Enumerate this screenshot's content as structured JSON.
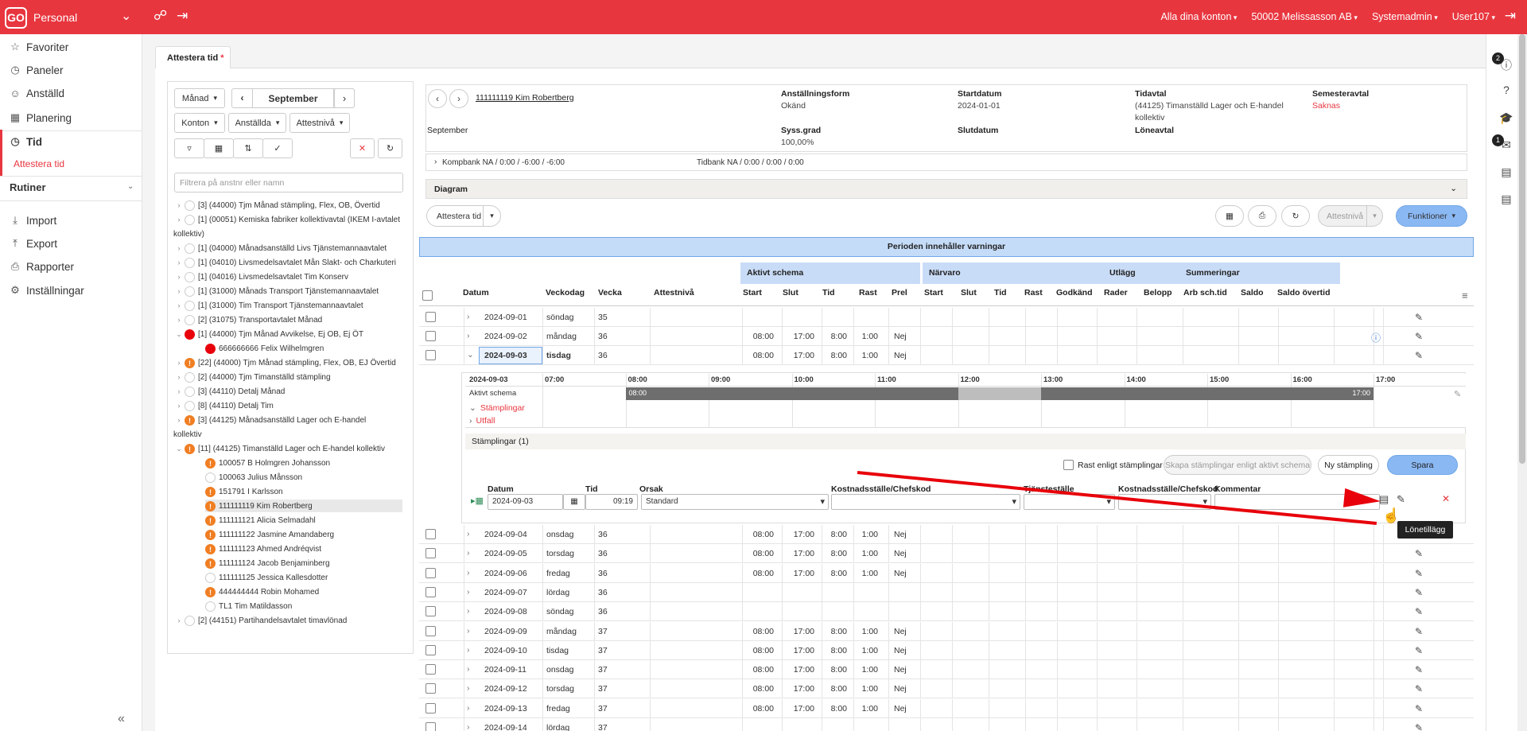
{
  "topbar": {
    "logo": "GO",
    "app_name": "Personal",
    "accounts": "Alla dina konton",
    "company": "50002 Melissasson AB",
    "role": "Systemadmin",
    "user": "User107",
    "icons": [
      "lifebuoy-icon",
      "sign-out-icon",
      "logout-icon"
    ]
  },
  "sidebar": {
    "items": [
      {
        "label": "Favoriter",
        "icon": "star-icon"
      },
      {
        "label": "Paneler",
        "icon": "dashboard-icon"
      },
      {
        "label": "Anställd",
        "icon": "user-icon"
      },
      {
        "label": "Planering",
        "icon": "calendar-icon"
      },
      {
        "label": "Tid",
        "icon": "clock-icon"
      },
      {
        "label": "Import",
        "icon": "import-icon"
      },
      {
        "label": "Export",
        "icon": "export-icon"
      },
      {
        "label": "Rapporter",
        "icon": "print-icon"
      },
      {
        "label": "Inställningar",
        "icon": "gear-icon"
      }
    ],
    "sub_active": "Attestera tid",
    "section": "Rutiner"
  },
  "tab": {
    "label": "Attestera tid",
    "star": "*"
  },
  "left": {
    "period": "Månad",
    "month": "September",
    "filters": [
      "Konton",
      "Anställda",
      "Attestnivå"
    ],
    "search_placeholder": "Filtrera på anstnr eller namn",
    "tree": [
      {
        "text": "[3]   (44000) Tjm Månad stämpling, Flex, OB, Övertid",
        "state": "empty",
        "lvl": 0,
        "chev": ">"
      },
      {
        "text": "[1]   (00051) Kemiska fabriker kollektivavtal (IKEM I-avtalet",
        "state": "empty",
        "lvl": 0,
        "chev": ">"
      },
      {
        "text": "kollektiv)",
        "state": "none",
        "lvl": -1,
        "chev": ""
      },
      {
        "text": "[1]   (04000) Månadsanställd Livs Tjänstemannaavtalet",
        "state": "empty",
        "lvl": 0,
        "chev": ">"
      },
      {
        "text": "[1]   (04010) Livsmedelsavtalet Mån Slakt- och Charkuteri",
        "state": "empty",
        "lvl": 0,
        "chev": ">"
      },
      {
        "text": "[1]   (04016) Livsmedelsavtalet Tim Konserv",
        "state": "empty",
        "lvl": 0,
        "chev": ">"
      },
      {
        "text": "[1]   (31000) Månads Transport Tjänstemannaavtalet",
        "state": "empty",
        "lvl": 0,
        "chev": ">"
      },
      {
        "text": "[1]   (31000) Tim Transport Tjänstemannaavtalet",
        "state": "empty",
        "lvl": 0,
        "chev": ">"
      },
      {
        "text": "[2]   (31075) Transportavtalet Månad",
        "state": "empty",
        "lvl": 0,
        "chev": ">"
      },
      {
        "text": "[1]   (44000) Tjm Månad Avvikelse, Ej OB, Ej ÖT",
        "state": "red",
        "lvl": 0,
        "chev": "v"
      },
      {
        "text": "666666666 Felix Wilhelmgren",
        "state": "red",
        "lvl": 1,
        "chev": ""
      },
      {
        "text": "[22]   (44000) Tjm Månad stämpling, Flex, OB, EJ Övertid",
        "state": "warn",
        "lvl": 0,
        "chev": ">"
      },
      {
        "text": "[2]   (44000) Tjm Timanställd stämpling",
        "state": "empty",
        "lvl": 0,
        "chev": ">"
      },
      {
        "text": "[3]   (44110) Detalj Månad",
        "state": "empty",
        "lvl": 0,
        "chev": ">"
      },
      {
        "text": "[8]   (44110) Detalj Tim",
        "state": "empty",
        "lvl": 0,
        "chev": ">"
      },
      {
        "text": "[3]   (44125) Månadsanställd Lager och E-handel",
        "state": "warn",
        "lvl": 0,
        "chev": ">"
      },
      {
        "text": "kollektiv",
        "state": "none",
        "lvl": -1,
        "chev": ""
      },
      {
        "text": "[11]   (44125) Timanställd Lager och E-handel kollektiv",
        "state": "warn",
        "lvl": 0,
        "chev": "v"
      },
      {
        "text": "100057 B Holmgren Johansson",
        "state": "warn",
        "lvl": 1,
        "chev": ""
      },
      {
        "text": "100063 Julius Månsson",
        "state": "empty",
        "lvl": 1,
        "chev": ""
      },
      {
        "text": "151791 I Karlsson",
        "state": "warn",
        "lvl": 1,
        "chev": ""
      },
      {
        "text": "111111119 Kim Robertberg",
        "state": "warn",
        "lvl": 1,
        "chev": "",
        "sel": true
      },
      {
        "text": "111111121 Alicia Selmadahl",
        "state": "warn",
        "lvl": 1,
        "chev": ""
      },
      {
        "text": "111111122 Jasmine Amandaberg",
        "state": "warn",
        "lvl": 1,
        "chev": ""
      },
      {
        "text": "111111123 Ahmed Andréqvist",
        "state": "warn",
        "lvl": 1,
        "chev": ""
      },
      {
        "text": "111111124 Jacob Benjaminberg",
        "state": "warn",
        "lvl": 1,
        "chev": ""
      },
      {
        "text": "111111125 Jessica Kallesdotter",
        "state": "empty",
        "lvl": 1,
        "chev": ""
      },
      {
        "text": "444444444 Robin Mohamed",
        "state": "warn",
        "lvl": 1,
        "chev": ""
      },
      {
        "text": "TL1 Tim Matildasson",
        "state": "empty",
        "lvl": 1,
        "chev": ""
      },
      {
        "text": "[2]   (44151) Partihandelsavtalet timavlönad",
        "state": "empty",
        "lvl": 0,
        "chev": ">"
      }
    ]
  },
  "employee": {
    "link": "111111119 Kim Robertberg",
    "period": "September",
    "anstform_lbl": "Anställningsform",
    "anstform": "Okänd",
    "sysgrad_lbl": "Syss.grad",
    "sysgrad": "100,00%",
    "start_lbl": "Startdatum",
    "start": "2024-01-01",
    "slut_lbl": "Slutdatum",
    "tidavtal_lbl": "Tidavtal",
    "tidavtal": "(44125) Timanställd Lager och E-handel",
    "tidavtal2": "kollektiv",
    "loneavtal_lbl": "Löneavtal",
    "semester_lbl": "Semesteravtal",
    "semester": "Saknas",
    "kompbank": "Kompbank  NA / 0:00 / -6:00 / -6:00",
    "tidbank": "Tidbank  NA / 0:00 / 0:00 / 0:00"
  },
  "diagram": "Diagram",
  "actions": {
    "attest": "Attestera tid",
    "attestniva": "Attestnivå",
    "funktioner": "Funktioner"
  },
  "warning": "Perioden innehåller varningar",
  "groups": {
    "aktivt": "Aktivt schema",
    "narvaro": "Närvaro",
    "utlagg": "Utlägg",
    "summ": "Summeringar"
  },
  "headers": [
    "Datum",
    "Veckodag",
    "Vecka",
    "Attestnivå",
    "Start",
    "Slut",
    "Tid",
    "Rast",
    "Prel",
    "Start",
    "Slut",
    "Tid",
    "Rast",
    "Godkänd",
    "Rader",
    "Belopp",
    "Arb sch.tid",
    "Saldo",
    "Saldo övertid"
  ],
  "rows_top": [
    {
      "date": "2024-09-01",
      "day": "söndag",
      "week": "35",
      "start": "",
      "slut": "",
      "tid": "",
      "rast": "",
      "prel": ""
    },
    {
      "date": "2024-09-02",
      "day": "måndag",
      "week": "36",
      "start": "08:00",
      "slut": "17:00",
      "tid": "8:00",
      "rast": "1:00",
      "prel": "Nej"
    },
    {
      "date": "2024-09-03",
      "day": "tisdag",
      "week": "36",
      "start": "08:00",
      "slut": "17:00",
      "tid": "8:00",
      "rast": "1:00",
      "prel": "Nej"
    }
  ],
  "rows_bottom": [
    {
      "date": "2024-09-04",
      "day": "onsdag",
      "week": "36",
      "start": "08:00",
      "slut": "17:00",
      "tid": "8:00",
      "rast": "1:00",
      "prel": "Nej"
    },
    {
      "date": "2024-09-05",
      "day": "torsdag",
      "week": "36",
      "start": "08:00",
      "slut": "17:00",
      "tid": "8:00",
      "rast": "1:00",
      "prel": "Nej"
    },
    {
      "date": "2024-09-06",
      "day": "fredag",
      "week": "36",
      "start": "08:00",
      "slut": "17:00",
      "tid": "8:00",
      "rast": "1:00",
      "prel": "Nej"
    },
    {
      "date": "2024-09-07",
      "day": "lördag",
      "week": "36",
      "start": "",
      "slut": "",
      "tid": "",
      "rast": "",
      "prel": ""
    },
    {
      "date": "2024-09-08",
      "day": "söndag",
      "week": "36",
      "start": "",
      "slut": "",
      "tid": "",
      "rast": "",
      "prel": ""
    },
    {
      "date": "2024-09-09",
      "day": "måndag",
      "week": "37",
      "start": "08:00",
      "slut": "17:00",
      "tid": "8:00",
      "rast": "1:00",
      "prel": "Nej"
    },
    {
      "date": "2024-09-10",
      "day": "tisdag",
      "week": "37",
      "start": "08:00",
      "slut": "17:00",
      "tid": "8:00",
      "rast": "1:00",
      "prel": "Nej"
    },
    {
      "date": "2024-09-11",
      "day": "onsdag",
      "week": "37",
      "start": "08:00",
      "slut": "17:00",
      "tid": "8:00",
      "rast": "1:00",
      "prel": "Nej"
    },
    {
      "date": "2024-09-12",
      "day": "torsdag",
      "week": "37",
      "start": "08:00",
      "slut": "17:00",
      "tid": "8:00",
      "rast": "1:00",
      "prel": "Nej"
    },
    {
      "date": "2024-09-13",
      "day": "fredag",
      "week": "37",
      "start": "08:00",
      "slut": "17:00",
      "tid": "8:00",
      "rast": "1:00",
      "prel": "Nej"
    },
    {
      "date": "2024-09-14",
      "day": "lördag",
      "week": "37",
      "start": "",
      "slut": "",
      "tid": "",
      "rast": "",
      "prel": ""
    }
  ],
  "gantt": {
    "date": "2024-09-03",
    "hours": [
      "07:00",
      "08:00",
      "09:00",
      "10:00",
      "11:00",
      "12:00",
      "13:00",
      "14:00",
      "15:00",
      "16:00",
      "17:00"
    ],
    "aktivt": "Aktivt schema",
    "stamplingar": "Stämplingar",
    "utfall": "Utfall",
    "start": "08:00",
    "end": "17:00"
  },
  "stamp": {
    "section": "Stämplingar  (1)",
    "rast_lbl": "Rast enligt stämplingar",
    "skapa": "Skapa stämplingar enligt aktivt schema",
    "ny": "Ny stämpling",
    "spara": "Spara",
    "labels": {
      "datum": "Datum",
      "tid": "Tid",
      "orsak": "Orsak",
      "kost": "Kostnadsställe/Chefskod",
      "tjanst": "Tjänsteställe",
      "kost2": "Kostnadsställe/Chefskod",
      "komm": "Kommentar"
    },
    "date": "2024-09-03",
    "time": "09:19",
    "orsak": "Standard"
  },
  "tooltip": "Lönetillägg",
  "right_badges": {
    "first": "2",
    "second": "1"
  }
}
